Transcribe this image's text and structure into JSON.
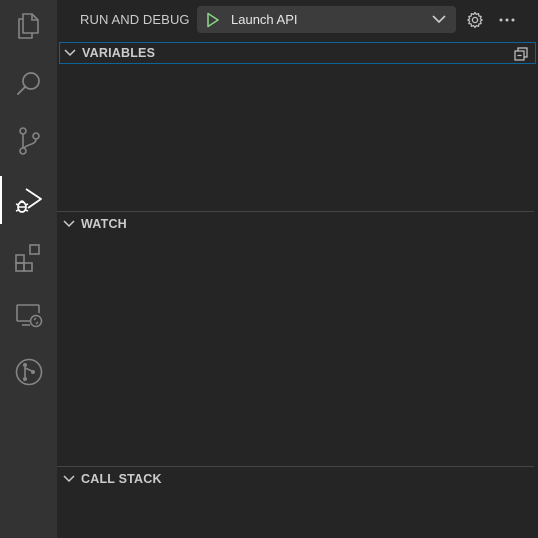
{
  "activity_bar": {
    "items": [
      {
        "icon": "files-icon",
        "active": false
      },
      {
        "icon": "search-icon",
        "active": false
      },
      {
        "icon": "source-control-icon",
        "active": false
      },
      {
        "icon": "run-debug-icon",
        "active": true
      },
      {
        "icon": "extensions-icon",
        "active": false
      },
      {
        "icon": "remote-explorer-icon",
        "active": false
      },
      {
        "icon": "git-graph-icon",
        "active": false
      }
    ]
  },
  "header": {
    "title": "RUN AND DEBUG",
    "launch_config": "Launch API",
    "play_icon": "play-icon",
    "gear_icon": "gear-icon",
    "more_icon": "more-icon"
  },
  "sections": {
    "variables": {
      "label": "VARIABLES"
    },
    "watch": {
      "label": "WATCH"
    },
    "call_stack": {
      "label": "CALL STACK"
    }
  },
  "colors": {
    "accent": "#0e639c",
    "play": "#89d185",
    "sidebar_bg": "#252526",
    "activity_bg": "#333333"
  }
}
